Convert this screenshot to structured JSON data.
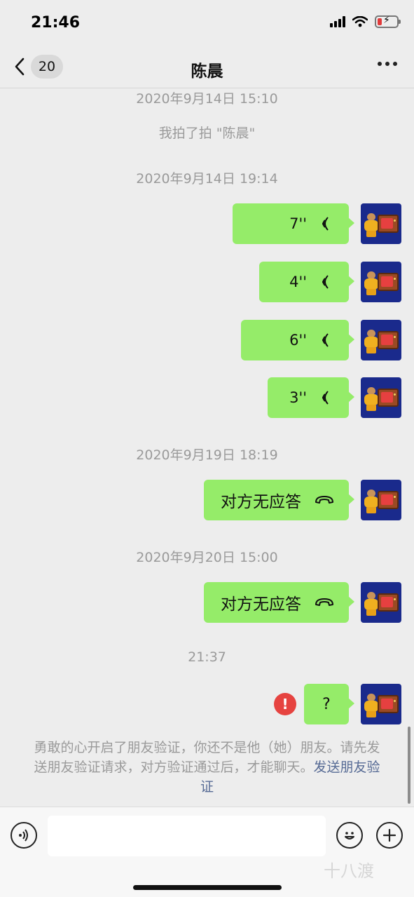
{
  "status_bar": {
    "time": "21:46"
  },
  "header": {
    "back_count": "20",
    "title": "陈晨"
  },
  "chat": {
    "timestamps": [
      "2020年9月14日 15:10",
      "2020年9月14日 19:14",
      "2020年9月19日 18:19",
      "2020年9月20日 15:00",
      "21:37"
    ],
    "pat_notice": "我拍了拍 \"陈晨\"",
    "voice_messages": [
      "7''",
      "4''",
      "6''",
      "3''"
    ],
    "call_messages": [
      "对方无应答",
      "对方无应答"
    ],
    "text_message": "?",
    "system_notice": "勇敢的心开启了朋友验证，你还不是他（她）朋友。请先发送朋友验证请求，对方验证通过后，才能聊天。",
    "system_notice_link": "发送朋友验证"
  },
  "watermark": "十八渡",
  "colors": {
    "bubble": "#95ec69",
    "background": "#ededed",
    "link": "#576b95",
    "error": "#e64340"
  },
  "icons": [
    "back-chevron-icon",
    "more-icon",
    "voice-wave-icon",
    "phone-hangup-icon",
    "error-icon",
    "voice-input-icon",
    "emoji-icon",
    "plus-icon"
  ]
}
